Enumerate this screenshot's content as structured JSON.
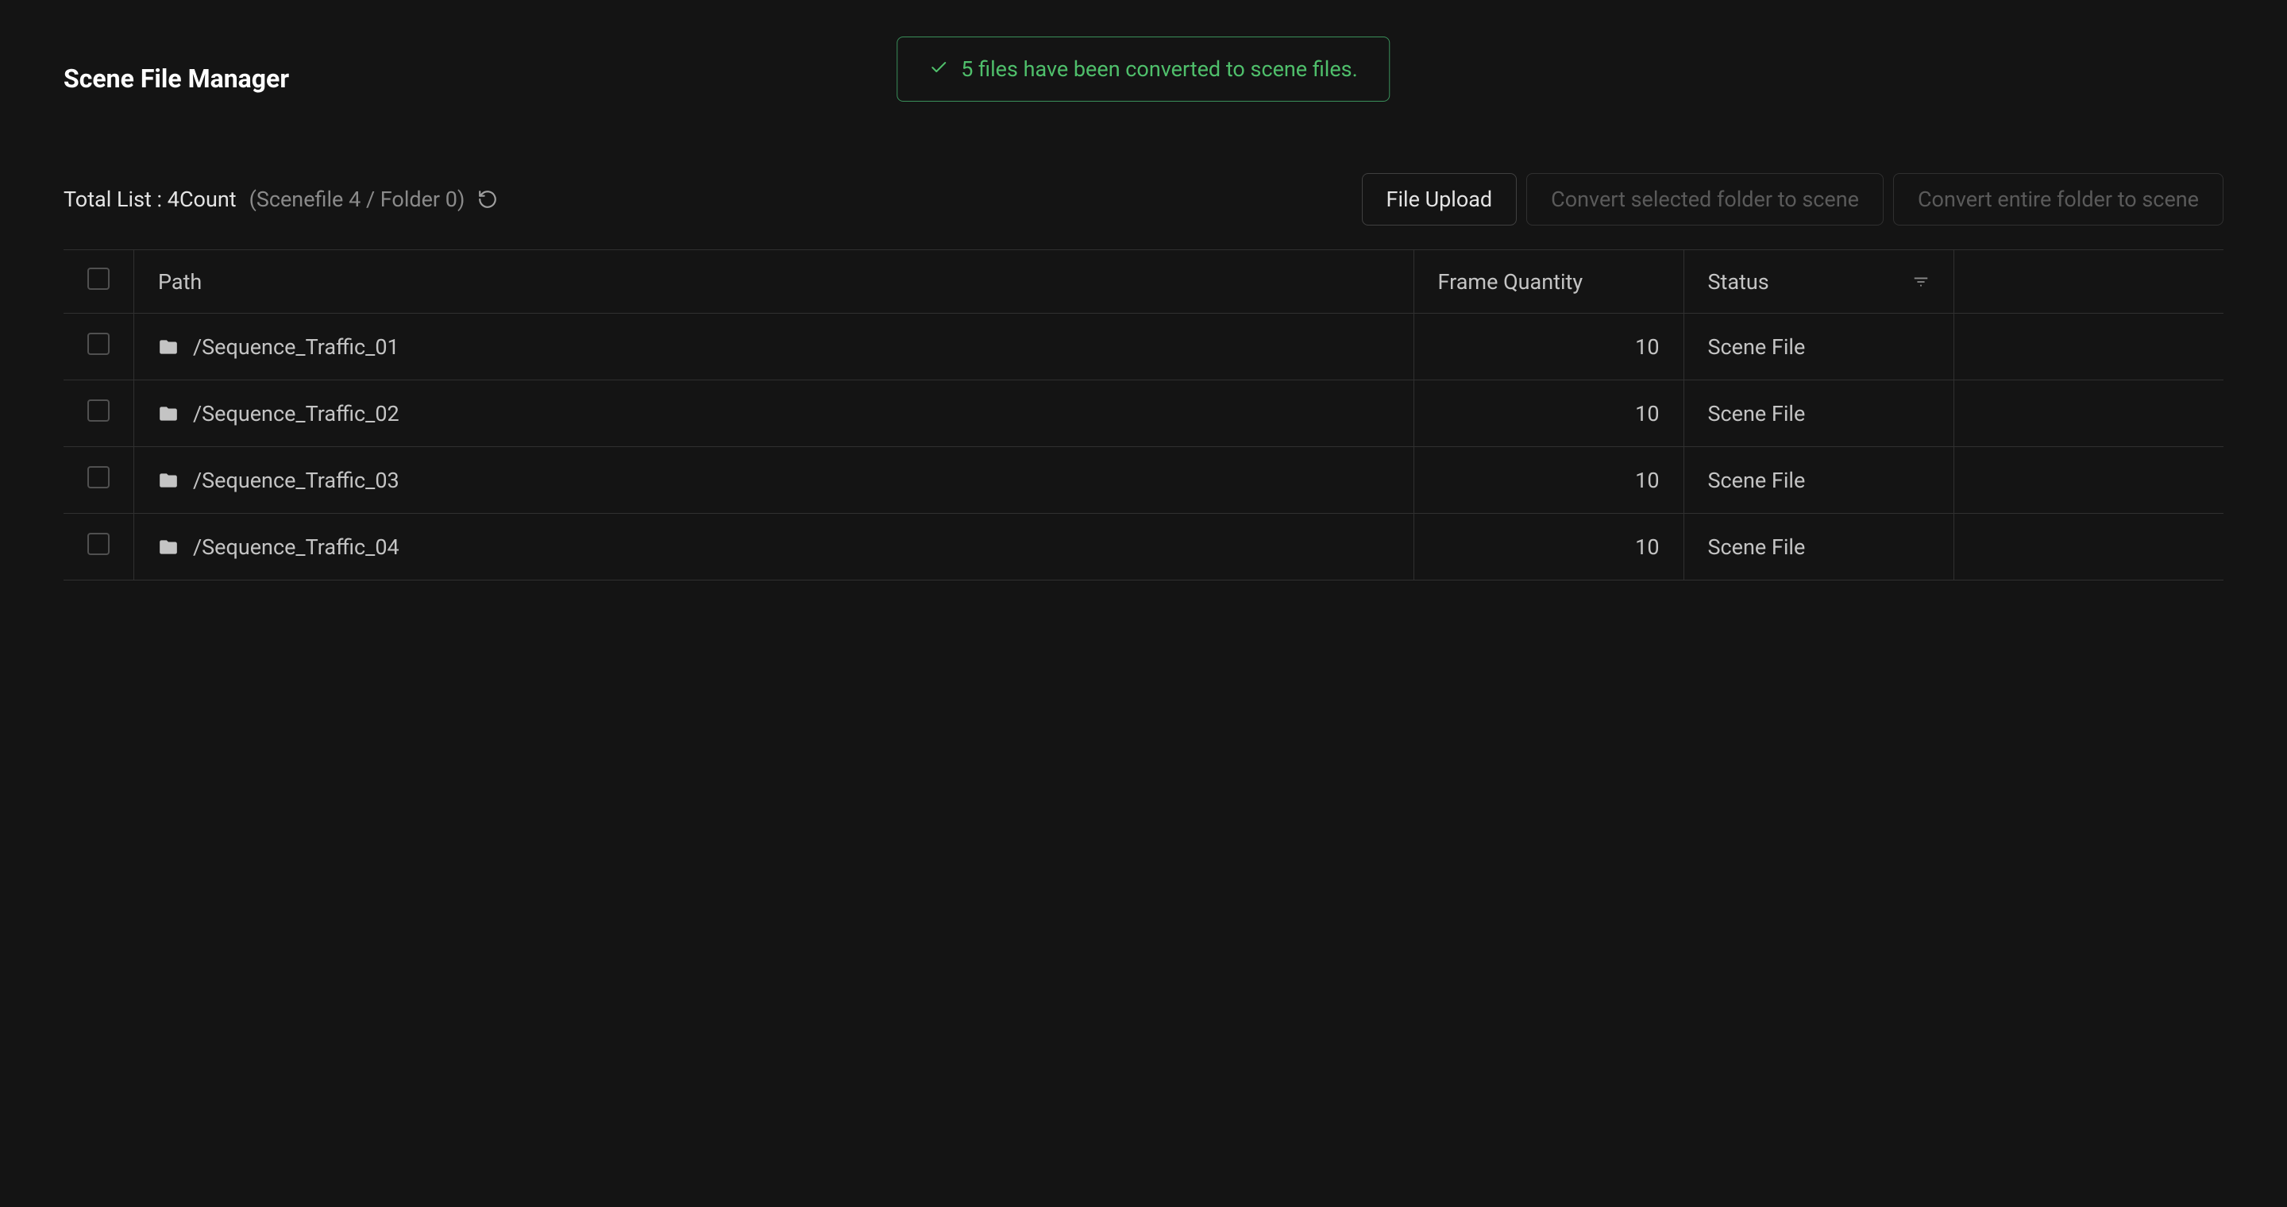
{
  "header": {
    "title": "Scene File Manager"
  },
  "toast": {
    "message": "5 files have been converted to scene files."
  },
  "toolbar": {
    "total_label": "Total List : 4Count",
    "total_detail": "(Scenefile 4 / Folder 0)",
    "upload_label": "File Upload",
    "convert_selected_label": "Convert selected folder to scene",
    "convert_entire_label": "Convert entire folder to scene"
  },
  "table": {
    "columns": {
      "path": "Path",
      "frame": "Frame Quantity",
      "status": "Status"
    },
    "rows": [
      {
        "path": "/Sequence_Traffic_01",
        "frame": "10",
        "status": "Scene File"
      },
      {
        "path": "/Sequence_Traffic_02",
        "frame": "10",
        "status": "Scene File"
      },
      {
        "path": "/Sequence_Traffic_03",
        "frame": "10",
        "status": "Scene File"
      },
      {
        "path": "/Sequence_Traffic_04",
        "frame": "10",
        "status": "Scene File"
      }
    ]
  }
}
